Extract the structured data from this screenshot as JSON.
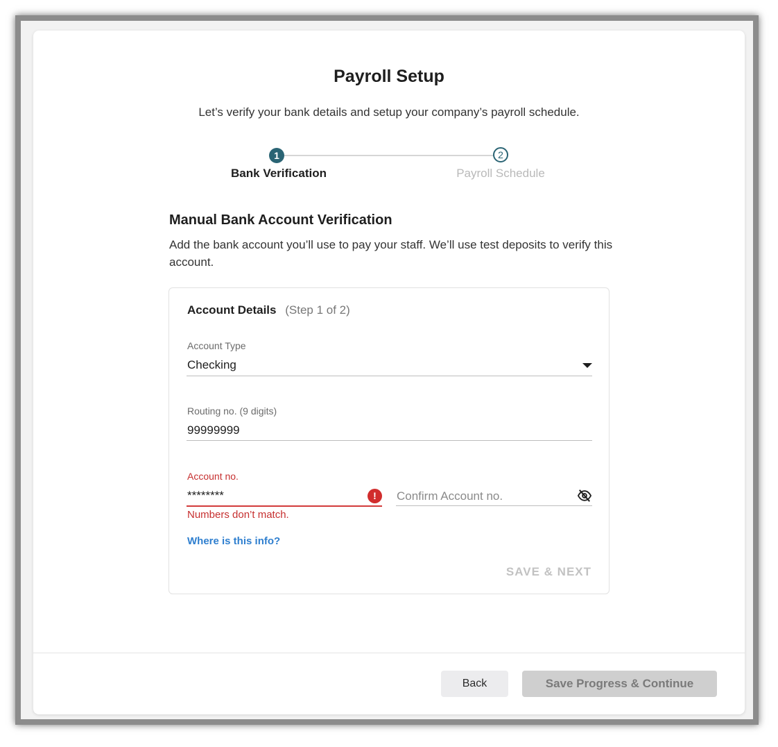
{
  "page": {
    "title": "Payroll Setup",
    "subtitle": "Let’s verify your bank details and setup your company’s payroll schedule."
  },
  "stepper": {
    "steps": [
      {
        "number": "1",
        "label": "Bank Verification",
        "state": "active"
      },
      {
        "number": "2",
        "label": "Payroll Schedule",
        "state": "inactive"
      }
    ]
  },
  "section": {
    "title": "Manual Bank Account Verification",
    "description": "Add the bank account you’ll use to pay your staff. We’ll use test deposits to verify this account."
  },
  "account_details": {
    "title": "Account Details",
    "step_text": "(Step 1 of 2)",
    "account_type": {
      "label": "Account Type",
      "value": "Checking"
    },
    "routing": {
      "label": "Routing no. (9 digits)",
      "value": "99999999"
    },
    "account_no": {
      "label": "Account no.",
      "value": "********",
      "error": "Numbers don’t match."
    },
    "confirm_account": {
      "placeholder": "Confirm Account no."
    },
    "help_link": "Where is this info?",
    "save_next": "SAVE & NEXT"
  },
  "footer": {
    "back": "Back",
    "primary": "Save Progress & Continue"
  },
  "colors": {
    "accent": "#2a6474",
    "error": "#c62f2f",
    "link": "#2f7fcf",
    "disabled": "#cfcfcf"
  }
}
